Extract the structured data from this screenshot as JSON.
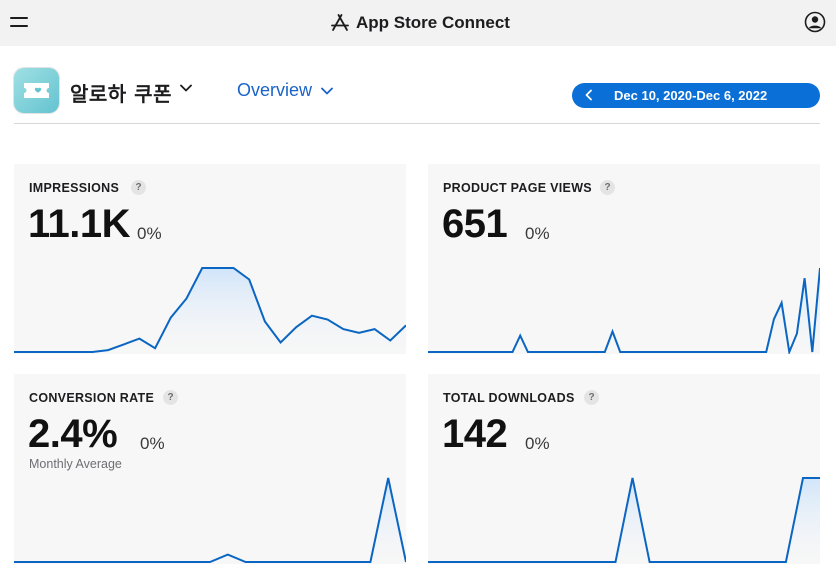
{
  "header": {
    "title": "App Store Connect",
    "menu_icon": "hamburger-menu-icon",
    "account_icon": "account-circle-icon"
  },
  "app": {
    "name": "알로하 쿠폰",
    "icon": "ticket-app-icon"
  },
  "view_selector": {
    "value": "Overview"
  },
  "date_range": {
    "label": "Dec 10, 2020-Dec 6, 2022"
  },
  "colors": {
    "accent": "#0a6fd6",
    "line": "#0a66c2",
    "fill_top": "#cfe4fa",
    "card_bg": "#f7f7f7"
  },
  "metrics": [
    {
      "title": "IMPRESSIONS",
      "value": "11.1K",
      "change": "0%",
      "subtitle": "",
      "trend": [
        0,
        0,
        0,
        0,
        0,
        0,
        1,
        4,
        7,
        2,
        18,
        28,
        44,
        44,
        44,
        38,
        16,
        5,
        13,
        19,
        17,
        12,
        10,
        12,
        6,
        14
      ]
    },
    {
      "title": "PRODUCT PAGE VIEWS",
      "value": "651",
      "change": "0%",
      "trend": [
        0,
        0,
        0,
        0,
        0,
        0,
        0,
        0,
        0,
        0,
        0,
        0,
        8,
        0,
        0,
        0,
        0,
        0,
        0,
        0,
        0,
        0,
        0,
        0,
        10,
        0,
        0,
        0,
        0,
        0,
        0,
        0,
        0,
        0,
        0,
        0,
        0,
        0,
        0,
        0,
        0,
        0,
        0,
        0,
        0,
        16,
        24,
        0,
        9,
        36,
        0,
        41
      ]
    },
    {
      "title": "CONVERSION RATE",
      "value": "2.4%",
      "change": "0%",
      "subtitle": "Monthly Average",
      "trend": [
        0,
        0,
        0,
        0,
        0,
        0,
        0,
        0,
        0,
        0,
        0,
        0,
        3,
        0,
        0,
        0,
        0,
        0,
        0,
        0,
        0,
        34,
        0
      ]
    },
    {
      "title": "TOTAL DOWNLOADS",
      "value": "142",
      "change": "0%",
      "trend": [
        0,
        0,
        0,
        0,
        0,
        0,
        0,
        0,
        0,
        0,
        0,
        0,
        28,
        0,
        0,
        0,
        0,
        0,
        0,
        0,
        0,
        0,
        28,
        28
      ]
    }
  ]
}
